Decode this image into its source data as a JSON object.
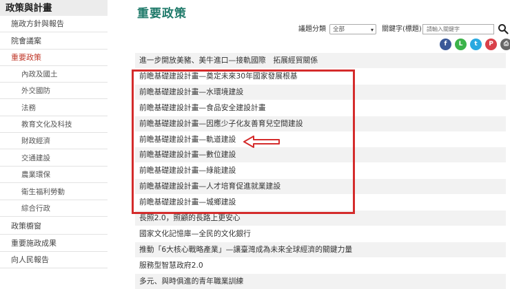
{
  "sidebar": {
    "header": "政策與計畫",
    "items": [
      {
        "label": "施政方針與報告",
        "type": "top",
        "active": false
      },
      {
        "label": "院會議案",
        "type": "top",
        "active": false
      },
      {
        "label": "重要政策",
        "type": "top",
        "active": true
      },
      {
        "label": "內政及國土",
        "type": "sub",
        "active": false
      },
      {
        "label": "外交國防",
        "type": "sub",
        "active": false
      },
      {
        "label": "法務",
        "type": "sub",
        "active": false
      },
      {
        "label": "教育文化及科技",
        "type": "sub",
        "active": false
      },
      {
        "label": "財政經濟",
        "type": "sub",
        "active": false
      },
      {
        "label": "交通建設",
        "type": "sub",
        "active": false
      },
      {
        "label": "農業環保",
        "type": "sub",
        "active": false
      },
      {
        "label": "衛生福利勞動",
        "type": "sub",
        "active": false
      },
      {
        "label": "綜合行政",
        "type": "sub",
        "active": false
      },
      {
        "label": "政策櫥窗",
        "type": "top",
        "active": false
      },
      {
        "label": "重要施政成果",
        "type": "top",
        "active": false
      },
      {
        "label": "向人民報告",
        "type": "top",
        "active": false
      }
    ]
  },
  "main": {
    "title": "重要政策",
    "filter": {
      "category_label": "議題分類",
      "category_value": "全部",
      "keyword_label": "關鍵字(標題)",
      "keyword_placeholder": "請輸入關鍵字"
    },
    "share_icons": [
      {
        "name": "facebook-icon",
        "glyph": "f",
        "color": "#3b5998"
      },
      {
        "name": "line-icon",
        "glyph": "L",
        "color": "#3cb34a"
      },
      {
        "name": "twitter-icon",
        "glyph": "t",
        "color": "#29a9e0"
      },
      {
        "name": "plurk-icon",
        "glyph": "P",
        "color": "#d9414a"
      },
      {
        "name": "print-icon",
        "glyph": "⎙",
        "color": "#666666"
      }
    ],
    "policies": [
      "進一步開放美豬、美牛進口—接軌國際　拓展經貿關係",
      "前瞻基礎建設計畫—奠定未來30年國家發展根基",
      "前瞻基礎建設計畫—水環境建設",
      "前瞻基礎建設計畫—食品安全建設計畫",
      "前瞻基礎建設計畫—因應少子化友善育兒空間建設",
      "前瞻基礎建設計畫—軌道建設",
      "前瞻基礎建設計畫—數位建設",
      "前瞻基礎建設計畫—綠能建設",
      "前瞻基礎建設計畫—人才培育促進就業建設",
      "前瞻基礎建設計畫—城鄉建設",
      "長照2.0，照顧的長路上更安心",
      "國家文化記憶庫—全民的文化銀行",
      "推動「6大核心戰略產業」—讓臺灣成為未來全球經濟的關鍵力量",
      "服務型智慧政府2.0",
      "多元、與時俱進的青年職業訓練"
    ]
  }
}
